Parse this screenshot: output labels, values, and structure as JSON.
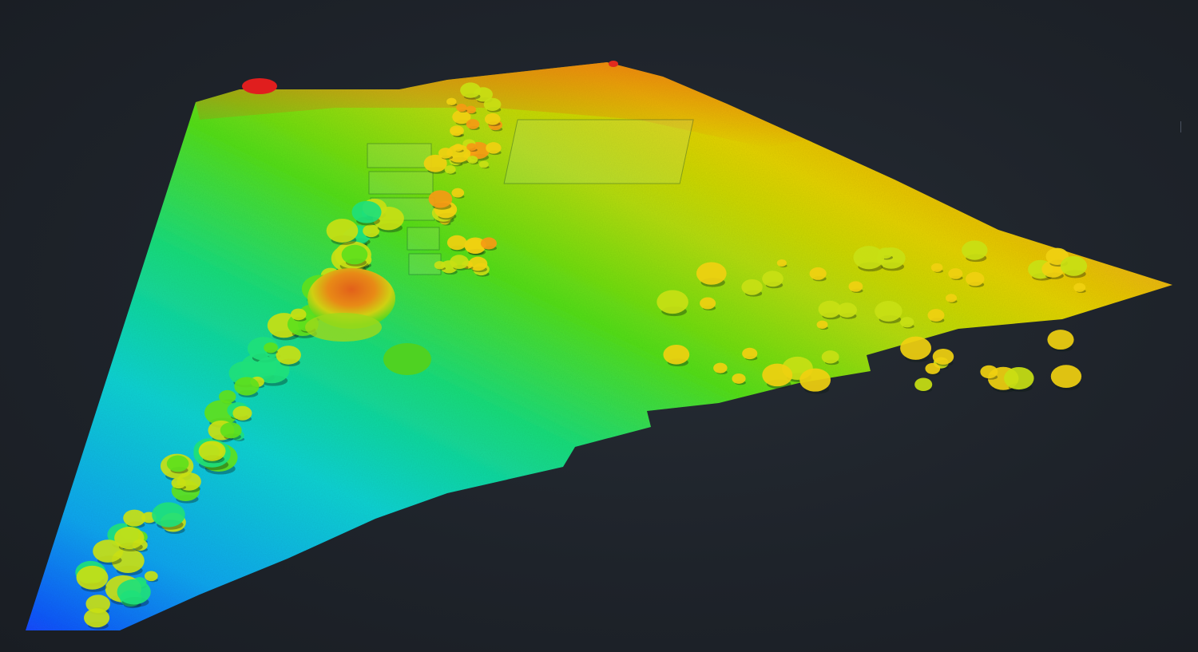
{
  "scene": {
    "kind": "lidar-point-cloud-elevation-view",
    "background_color": "#1f242b",
    "color_ramp": [
      "#1a3cff",
      "#14a8f0",
      "#12d6d0",
      "#1ee07a",
      "#5ee01c",
      "#c8e014",
      "#f0d010",
      "#f59a14",
      "#f05a14",
      "#e01e1e"
    ],
    "features": [
      "terrain-surface",
      "tree-canopy-clusters",
      "building-footprints",
      "tall-tree-crown"
    ]
  }
}
